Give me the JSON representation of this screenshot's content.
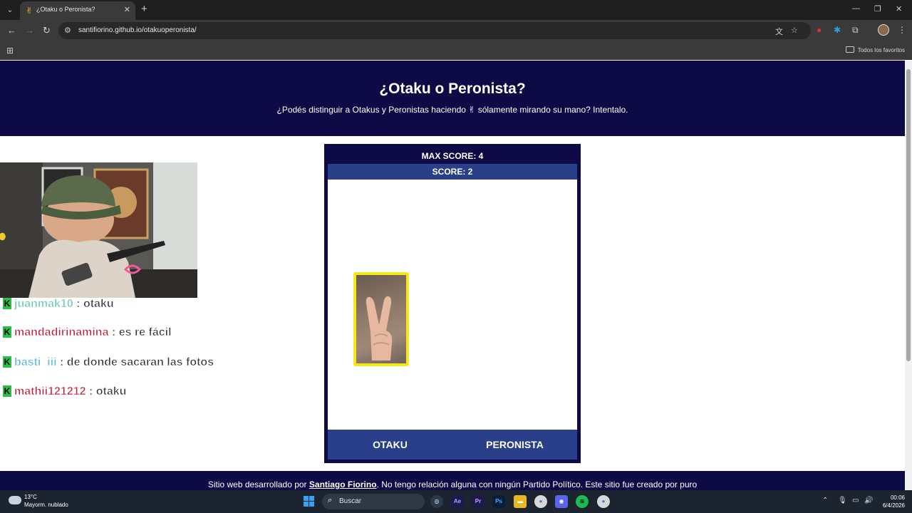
{
  "browser": {
    "tab_title": "¿Otaku o Peronista?",
    "tab_favicon": "✌",
    "url": "santifiorino.github.io/otakuoperonista/",
    "bookmarks_all": "Todos los favoritos"
  },
  "site": {
    "title": "¿Otaku o Peronista?",
    "subtitle": "¿Podés distinguir a Otakus y Peronistas haciendo ✌ sólamente mirando su mano? Intentalo.",
    "max_score_label": "MAX SCORE: 4",
    "score_label": "SCORE: 2",
    "button_otaku": "OTAKU",
    "button_peronista": "PERONISTA",
    "footer_prefix": "Sitio web desarrollado por ",
    "footer_author": "Santiago Fiorino",
    "footer_suffix": ". No tengo relación alguna con ningún Partido Político. Este sitio fue creado por puro"
  },
  "chat": [
    {
      "user": "juanmak10",
      "message": ": otaku",
      "color": "#5fc8b0"
    },
    {
      "user": "mandadirinamina",
      "message": ": es re fácil",
      "color": "#c0203a"
    },
    {
      "user": "basti_iii",
      "message": ": de donde sacaran las fotos",
      "color": "#4ab8e0"
    },
    {
      "user": "mathii121212",
      "message": ": otaku",
      "color": "#c0203a"
    }
  ],
  "taskbar": {
    "temperature": "13°C",
    "weather": "Mayorm. nublado",
    "search_placeholder": "Buscar",
    "time": "00:06",
    "date": "6/4/2026"
  },
  "colors": {
    "header_bg": "#0d0a45",
    "score_bar": "#2a3f8a",
    "card_border": "#f4e81a"
  }
}
